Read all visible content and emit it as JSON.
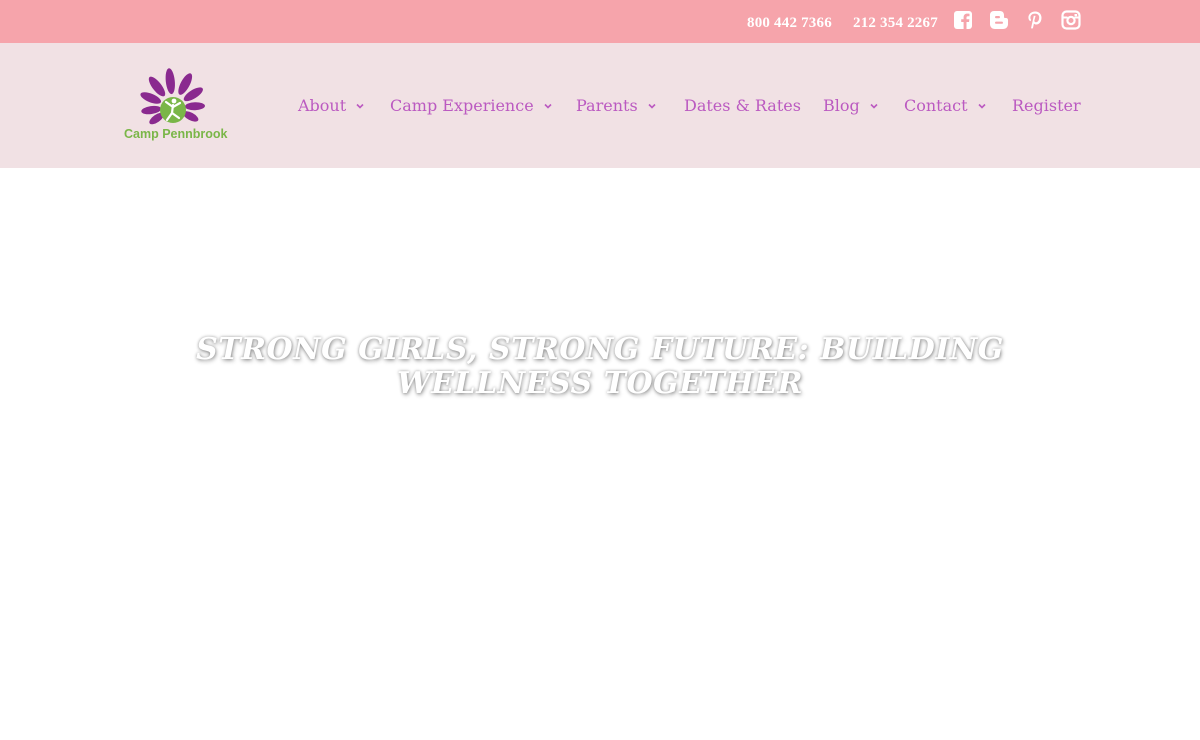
{
  "topbar": {
    "phone_1": "800 442 7366",
    "phone_2": "212 354 2267",
    "social": [
      "facebook-icon",
      "blogger-icon",
      "pinterest-icon",
      "instagram-icon"
    ],
    "background_color": "#f6a4ab"
  },
  "header": {
    "background_color": "#f1e1e4",
    "logo_text": "Camp Pennbrook",
    "nav": [
      {
        "label": "About",
        "has_dropdown": true
      },
      {
        "label": "Camp Experience",
        "has_dropdown": true
      },
      {
        "label": "Parents",
        "has_dropdown": true
      },
      {
        "label": "Dates & Rates",
        "has_dropdown": false
      },
      {
        "label": "Blog",
        "has_dropdown": true
      },
      {
        "label": "Contact",
        "has_dropdown": true
      },
      {
        "label": "Register",
        "has_dropdown": false
      }
    ],
    "nav_color": "#bb5ac1"
  },
  "hero": {
    "title": "STRONG GIRLS, STRONG FUTURE: BUILDING WELLNESS TOGETHER"
  }
}
